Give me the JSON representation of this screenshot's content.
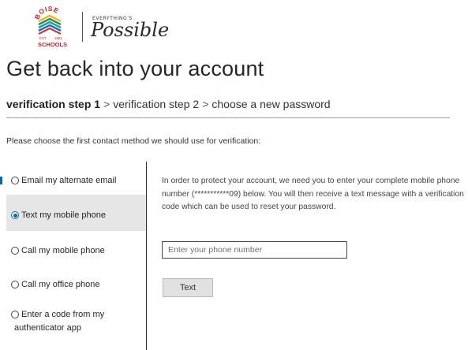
{
  "logo": {
    "school_word_top": "BOISE",
    "school_word_bottom": "SCHOOLS",
    "est": "EST",
    "year": "1881",
    "tagline_small": "EVERYTHING'S",
    "tagline_script": "Possible",
    "colors": {
      "red": "#c8242b",
      "yellow": "#f2b51d",
      "green": "#2e8b57",
      "blue": "#1d6fb8",
      "teal": "#1aa0a0"
    }
  },
  "page": {
    "title": "Get back into your account"
  },
  "breadcrumb": {
    "step1": "verification step 1",
    "step2": "verification step 2",
    "step3": "choose a new password",
    "separator": ">"
  },
  "instruction": "Please choose the first contact method we should use for verification:",
  "options": [
    {
      "label": "Email my alternate email",
      "selected": false
    },
    {
      "label": "Text my mobile phone",
      "selected": true
    },
    {
      "label": "Call my mobile phone",
      "selected": false
    },
    {
      "label": "Call my office phone",
      "selected": false
    },
    {
      "label_line1": "Enter a code from my",
      "label_line2": "authenticator app",
      "selected": false
    }
  ],
  "panel": {
    "description": "In order to protect your account, we need you to enter your complete mobile phone number (***********09) below. You will then receive a text message with a verification code which can be used to reset your password.",
    "phone_placeholder": "Enter your phone number",
    "phone_value": "",
    "send_button_label": "Text"
  },
  "colors": {
    "accent": "#0067b8",
    "selected_bg": "#e6e6e6",
    "button_bg": "#e1e1e1"
  }
}
